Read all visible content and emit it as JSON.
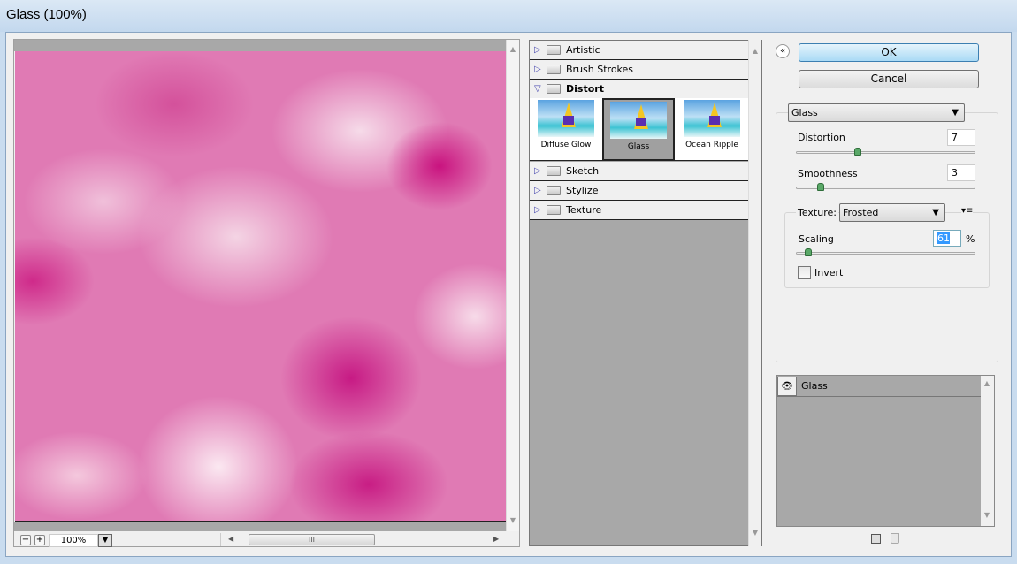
{
  "window": {
    "title": "Glass (100%)"
  },
  "preview": {
    "zoom": "100%",
    "zoom_out": "−",
    "zoom_in": "+",
    "dropdown_icon": "▼",
    "scroll_grip": "III"
  },
  "filters": {
    "categories": [
      {
        "label": "Artistic",
        "expanded": false
      },
      {
        "label": "Brush Strokes",
        "expanded": false
      },
      {
        "label": "Distort",
        "expanded": true
      },
      {
        "label": "Sketch",
        "expanded": false
      },
      {
        "label": "Stylize",
        "expanded": false
      },
      {
        "label": "Texture",
        "expanded": false
      }
    ],
    "distort_items": [
      "Diffuse Glow",
      "Glass",
      "Ocean Ripple"
    ],
    "selected": "Glass"
  },
  "buttons": {
    "ok": "OK",
    "cancel": "Cancel",
    "collapse": "«"
  },
  "settings": {
    "filter_select": "Glass",
    "distortion": {
      "label": "Distortion",
      "value": "7",
      "fraction": 0.35
    },
    "smoothness": {
      "label": "Smoothness",
      "value": "3",
      "fraction": 0.14
    },
    "texture": {
      "label": "Texture:",
      "value": "Frosted",
      "menu_icon": "▾≡"
    },
    "scaling": {
      "label": "Scaling",
      "value": "61",
      "unit": "%",
      "fraction": 0.07
    },
    "invert": {
      "label": "Invert",
      "checked": false
    }
  },
  "layers": {
    "items": [
      {
        "label": "Glass",
        "visible": true
      }
    ],
    "eye_icon": "👁"
  },
  "colors": {
    "selection": "#3399ff",
    "ok_border": "#3c7fb1",
    "slider_knob": "#5aa868"
  }
}
